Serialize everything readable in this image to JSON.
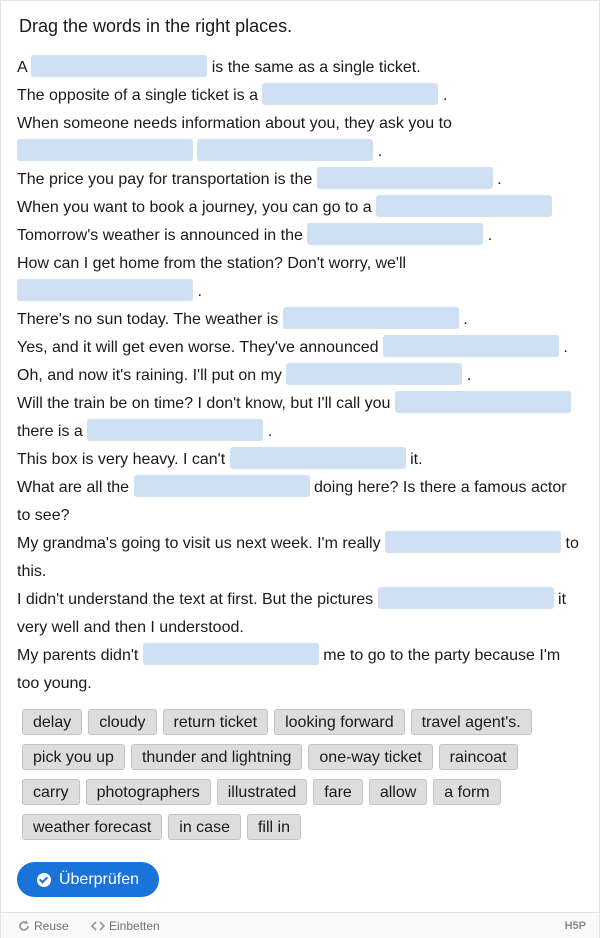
{
  "title": "Drag the words in the right places.",
  "sentences": [
    [
      "A",
      "",
      "is the same as a single ticket."
    ],
    [
      "The opposite of a single ticket is a",
      "",
      "."
    ],
    [
      "When someone needs information about you, they ask you to"
    ],
    [
      "",
      "",
      "."
    ],
    [
      "The price you pay for transportation is the",
      "",
      "."
    ],
    [
      "When you want to book a journey, you can go to a",
      ""
    ],
    [
      "Tomorrow's weather is announced in the",
      "",
      "."
    ],
    [
      "How can I get home from the station? Don't worry, we'll"
    ],
    [
      "",
      "."
    ],
    [
      "There's no sun today. The weather is",
      "",
      "."
    ],
    [
      "Yes, and it will get even worse. They've announced",
      "",
      "."
    ],
    [
      "Oh, and now it's raining. I'll put on my",
      "",
      "."
    ],
    [
      "Will the train be on time? I don't know, but I'll call you",
      ""
    ],
    [
      "there is a",
      "",
      "."
    ],
    [
      "This box is very heavy. I can't",
      "",
      "it."
    ],
    [
      "What are all the",
      "",
      "doing here? Is there a famous actor"
    ],
    [
      "to see?"
    ],
    [
      "My grandma's going to visit us next week. I'm really",
      "",
      "to"
    ],
    [
      "this."
    ],
    [
      "I didn't understand the text at first. But the pictures",
      "",
      "it"
    ],
    [
      "very well and then I understood."
    ],
    [
      "My parents didn't",
      "",
      "me to go to the party because I'm"
    ],
    [
      "too young."
    ]
  ],
  "words": [
    [
      "delay",
      "cloudy",
      "return ticket",
      "looking forward",
      "travel agent's."
    ],
    [
      "pick you up",
      "thunder and lightning",
      "one-way ticket",
      "raincoat"
    ],
    [
      "carry",
      "photographers",
      "illustrated",
      "fare",
      "allow",
      "a form"
    ],
    [
      "weather forecast",
      "in case",
      "fill in"
    ]
  ],
  "check_button": "Überprüfen",
  "check_icon": "check-circle-icon",
  "footer": {
    "reuse": "Reuse",
    "reuse_icon": "reuse-icon",
    "embed": "Einbetten",
    "embed_icon": "embed-icon",
    "logo": "H5P"
  },
  "colors": {
    "dropzone": "#cfe0f4",
    "chip": "#dddddd",
    "button": "#1a73d9"
  }
}
